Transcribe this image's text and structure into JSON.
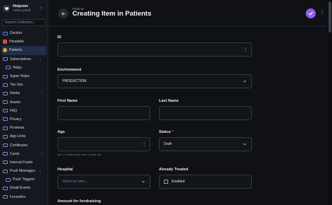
{
  "brand": {
    "name": "Helpster",
    "role": "Admin panel"
  },
  "sidebar": {
    "search_placeholder": "Search Collection...",
    "items": [
      {
        "label": "Doctors"
      },
      {
        "label": "Hospitals"
      },
      {
        "label": "Patients"
      },
      {
        "label": "Subscriptions"
      },
      {
        "label": "Helps"
      },
      {
        "label": "Super Helps"
      },
      {
        "label": "Top Ups"
      },
      {
        "label": "Ranks"
      },
      {
        "label": "Assets"
      },
      {
        "label": "FAQ"
      },
      {
        "label": "Privacy"
      },
      {
        "label": "Previews"
      },
      {
        "label": "App Links"
      },
      {
        "label": "Certificates"
      },
      {
        "label": "Cards"
      },
      {
        "label": "Internal Funds"
      },
      {
        "label": "Push Messages"
      },
      {
        "label": "Push Triggers"
      },
      {
        "label": "Email Events"
      },
      {
        "label": "Funnelfox"
      }
    ]
  },
  "header": {
    "breadcrumb": "Patients",
    "title": "Creating Item in Patients"
  },
  "form": {
    "id": {
      "label": "ID",
      "value": ""
    },
    "environment": {
      "label": "Environment",
      "value": "PRODUCTION"
    },
    "first_name": {
      "label": "First Name",
      "value": ""
    },
    "last_name": {
      "label": "Last Name",
      "value": ""
    },
    "age": {
      "label": "Age",
      "value": "",
      "hint": "put 1, if child is less than 1 years old"
    },
    "status": {
      "label": "Status",
      "required_mark": "*",
      "value": "Draft"
    },
    "hospital": {
      "label": "Hospital",
      "placeholder": "Select an item..."
    },
    "already_treated": {
      "label": "Already Treated",
      "option": "Enabled",
      "checked": false
    },
    "amount": {
      "label": "Amount for fundraising"
    }
  },
  "colors": {
    "accent": "#8e5df0",
    "active_nav": "#1f2e4a",
    "background": "#0f1115"
  }
}
